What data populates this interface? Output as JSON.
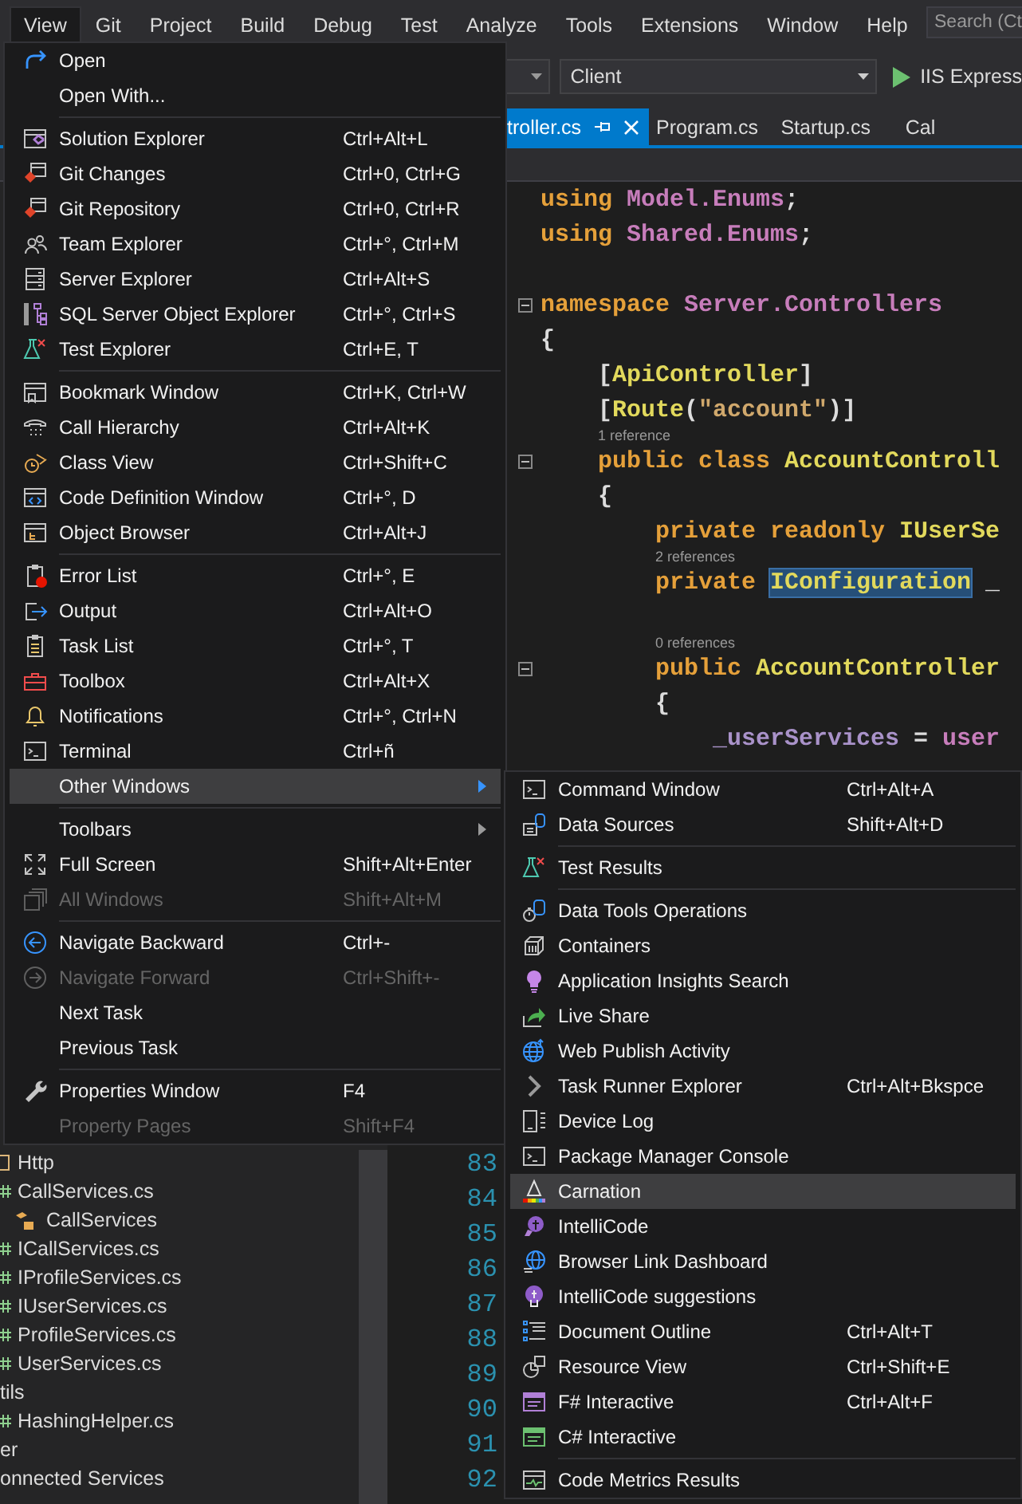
{
  "menu_bar": {
    "items": [
      {
        "label": "View",
        "selected": true
      },
      {
        "label": "Git",
        "selected": false
      },
      {
        "label": "Project",
        "selected": false
      },
      {
        "label": "Build",
        "selected": false
      },
      {
        "label": "Debug",
        "selected": false
      },
      {
        "label": "Test",
        "selected": false
      },
      {
        "label": "Analyze",
        "selected": false
      },
      {
        "label": "Tools",
        "selected": false
      },
      {
        "label": "Extensions",
        "selected": false
      },
      {
        "label": "Window",
        "selected": false
      },
      {
        "label": "Help",
        "selected": false
      }
    ],
    "search": {
      "placeholder": "Search (Ct"
    }
  },
  "toolbar": {
    "startup_project": "Client",
    "run_button": "IIS Express"
  },
  "tabs": [
    {
      "label": "troller.cs",
      "selected": true
    },
    {
      "label": "Program.cs",
      "selected": false
    },
    {
      "label": "Startup.cs",
      "selected": false
    },
    {
      "label": "Cal",
      "selected": false
    }
  ],
  "solution_explorer": {
    "tree": [
      {
        "label": "Http",
        "kind": "folder"
      },
      {
        "label": "CallServices.cs",
        "kind": "file",
        "children": [
          {
            "label": "CallServices",
            "kind": "class"
          }
        ]
      },
      {
        "label": "ICallServices.cs",
        "kind": "file"
      },
      {
        "label": "IProfileServices.cs",
        "kind": "file"
      },
      {
        "label": "IUserServices.cs",
        "kind": "file"
      },
      {
        "label": "ProfileServices.cs",
        "kind": "file"
      },
      {
        "label": "UserServices.cs",
        "kind": "file"
      },
      {
        "label": "tils",
        "kind": "node",
        "children": [
          {
            "label": "HashingHelper.cs",
            "kind": "file"
          }
        ]
      },
      {
        "label": "er",
        "kind": "node"
      },
      {
        "label": "onnected Services",
        "kind": "node"
      }
    ]
  },
  "line_numbers": [
    "83",
    "84",
    "85",
    "86",
    "87",
    "88",
    "89",
    "90",
    "91",
    "92"
  ],
  "code": {
    "lines": [
      {
        "kind": "code",
        "collapsible": false,
        "tokens": [
          {
            "text": "using ",
            "kind": "keyword"
          },
          {
            "text": "Model.Enums",
            "kind": "namespace"
          },
          {
            "text": ";",
            "kind": "plain"
          }
        ]
      },
      {
        "kind": "code",
        "collapsible": false,
        "tokens": [
          {
            "text": "using ",
            "kind": "keyword"
          },
          {
            "text": "Shared.Enums",
            "kind": "namespace"
          },
          {
            "text": ";",
            "kind": "plain"
          }
        ]
      },
      {
        "kind": "blank",
        "collapsible": false
      },
      {
        "kind": "code",
        "collapsible": true,
        "tokens": [
          {
            "text": "namespace ",
            "kind": "keyword"
          },
          {
            "text": "Server.Controllers",
            "kind": "namespace"
          }
        ]
      },
      {
        "kind": "code",
        "collapsible": false,
        "tokens": [
          {
            "text": "{",
            "kind": "plain"
          }
        ],
        "children": [
          {
            "kind": "code",
            "collapsible": false,
            "tokens": [
              {
                "text": "[",
                "kind": "plain"
              },
              {
                "text": "ApiController",
                "kind": "type"
              },
              {
                "text": "]",
                "kind": "plain"
              }
            ]
          },
          {
            "kind": "code",
            "collapsible": false,
            "tokens": [
              {
                "text": "[",
                "kind": "plain"
              },
              {
                "text": "Route",
                "kind": "type"
              },
              {
                "text": "(",
                "kind": "plain"
              },
              {
                "text": "\"account\"",
                "kind": "string"
              },
              {
                "text": ")]",
                "kind": "plain"
              }
            ]
          },
          {
            "kind": "hint",
            "collapsible": false,
            "tokens": [
              {
                "text": "1 reference",
                "kind": "hint"
              }
            ]
          },
          {
            "kind": "code",
            "collapsible": true,
            "tokens": [
              {
                "text": "public class ",
                "kind": "keyword"
              },
              {
                "text": "AccountControll",
                "kind": "type"
              }
            ]
          },
          {
            "kind": "code",
            "collapsible": false,
            "tokens": [
              {
                "text": "{",
                "kind": "plain"
              }
            ],
            "children": [
              {
                "kind": "code",
                "collapsible": false,
                "tokens": [
                  {
                    "text": "private readonly ",
                    "kind": "keyword"
                  },
                  {
                    "text": "IUserSe",
                    "kind": "type"
                  }
                ]
              },
              {
                "kind": "hint",
                "collapsible": false,
                "tokens": [
                  {
                    "text": "2 references",
                    "kind": "hint"
                  }
                ]
              },
              {
                "kind": "code",
                "collapsible": false,
                "tokens": [
                  {
                    "text": "private ",
                    "kind": "keyword"
                  },
                  {
                    "text": "IConfiguration",
                    "kind": "selected"
                  },
                  {
                    "text": " _",
                    "kind": "plain"
                  }
                ]
              },
              {
                "kind": "blank",
                "collapsible": false
              },
              {
                "kind": "hint",
                "collapsible": false,
                "tokens": [
                  {
                    "text": "0 references",
                    "kind": "hint"
                  }
                ]
              },
              {
                "kind": "code",
                "collapsible": true,
                "tokens": [
                  {
                    "text": "public ",
                    "kind": "keyword"
                  },
                  {
                    "text": "AccountController",
                    "kind": "type"
                  }
                ]
              },
              {
                "kind": "code",
                "collapsible": false,
                "tokens": [
                  {
                    "text": "{",
                    "kind": "plain"
                  }
                ],
                "children": [
                  {
                    "kind": "code",
                    "collapsible": false,
                    "tokens": [
                      {
                        "text": "_userServices",
                        "kind": "field"
                      },
                      {
                        "text": " = ",
                        "kind": "plain"
                      },
                      {
                        "text": "user",
                        "kind": "parameter"
                      }
                    ]
                  }
                ]
              }
            ]
          }
        ]
      }
    ]
  },
  "view_menu": {
    "groups": [
      [
        {
          "label": "Open",
          "disabled": false,
          "selected": false,
          "submenu": false
        },
        {
          "label": "Open With...",
          "disabled": false,
          "selected": false,
          "submenu": false
        }
      ],
      [
        {
          "label": "Solution Explorer",
          "shortcut": "Ctrl+Alt+L",
          "disabled": false,
          "selected": false,
          "submenu": false
        },
        {
          "label": "Git Changes",
          "shortcut": "Ctrl+0, Ctrl+G",
          "disabled": false,
          "selected": false,
          "submenu": false
        },
        {
          "label": "Git Repository",
          "shortcut": "Ctrl+0, Ctrl+R",
          "disabled": false,
          "selected": false,
          "submenu": false
        },
        {
          "label": "Team Explorer",
          "shortcut": "Ctrl+°, Ctrl+M",
          "disabled": false,
          "selected": false,
          "submenu": false
        },
        {
          "label": "Server Explorer",
          "shortcut": "Ctrl+Alt+S",
          "disabled": false,
          "selected": false,
          "submenu": false
        },
        {
          "label": "SQL Server Object Explorer",
          "shortcut": "Ctrl+°, Ctrl+S",
          "disabled": false,
          "selected": false,
          "submenu": false
        },
        {
          "label": "Test Explorer",
          "shortcut": "Ctrl+E, T",
          "disabled": false,
          "selected": false,
          "submenu": false
        }
      ],
      [
        {
          "label": "Bookmark Window",
          "shortcut": "Ctrl+K, Ctrl+W",
          "disabled": false,
          "selected": false,
          "submenu": false
        },
        {
          "label": "Call Hierarchy",
          "shortcut": "Ctrl+Alt+K",
          "disabled": false,
          "selected": false,
          "submenu": false
        },
        {
          "label": "Class View",
          "shortcut": "Ctrl+Shift+C",
          "disabled": false,
          "selected": false,
          "submenu": false
        },
        {
          "label": "Code Definition Window",
          "shortcut": "Ctrl+°, D",
          "disabled": false,
          "selected": false,
          "submenu": false
        },
        {
          "label": "Object Browser",
          "shortcut": "Ctrl+Alt+J",
          "disabled": false,
          "selected": false,
          "submenu": false
        }
      ],
      [
        {
          "label": "Error List",
          "shortcut": "Ctrl+°, E",
          "disabled": false,
          "selected": false,
          "submenu": false
        },
        {
          "label": "Output",
          "shortcut": "Ctrl+Alt+O",
          "disabled": false,
          "selected": false,
          "submenu": false
        },
        {
          "label": "Task List",
          "shortcut": "Ctrl+°, T",
          "disabled": false,
          "selected": false,
          "submenu": false
        },
        {
          "label": "Toolbox",
          "shortcut": "Ctrl+Alt+X",
          "disabled": false,
          "selected": false,
          "submenu": false
        },
        {
          "label": "Notifications",
          "shortcut": "Ctrl+°, Ctrl+N",
          "disabled": false,
          "selected": false,
          "submenu": false
        },
        {
          "label": "Terminal",
          "shortcut": "Ctrl+ñ",
          "disabled": false,
          "selected": false,
          "submenu": false
        },
        {
          "label": "Other Windows",
          "disabled": false,
          "selected": true,
          "submenu": true
        }
      ],
      [
        {
          "label": "Toolbars",
          "disabled": false,
          "selected": false,
          "submenu": true
        },
        {
          "label": "Full Screen",
          "shortcut": "Shift+Alt+Enter",
          "disabled": false,
          "selected": false,
          "submenu": false
        },
        {
          "label": "All Windows",
          "shortcut": "Shift+Alt+M",
          "disabled": true,
          "selected": false,
          "submenu": false
        }
      ],
      [
        {
          "label": "Navigate Backward",
          "shortcut": "Ctrl+-",
          "disabled": false,
          "selected": false,
          "submenu": false
        },
        {
          "label": "Navigate Forward",
          "shortcut": "Ctrl+Shift+-",
          "disabled": true,
          "selected": false,
          "submenu": false
        },
        {
          "label": "Next Task",
          "disabled": false,
          "selected": false,
          "submenu": false
        },
        {
          "label": "Previous Task",
          "disabled": false,
          "selected": false,
          "submenu": false
        }
      ],
      [
        {
          "label": "Properties Window",
          "shortcut": "F4",
          "disabled": false,
          "selected": false,
          "submenu": false
        },
        {
          "label": "Property Pages",
          "shortcut": "Shift+F4",
          "disabled": true,
          "selected": false,
          "submenu": false
        }
      ]
    ]
  },
  "other_windows_menu": {
    "groups": [
      [
        {
          "label": "Command Window",
          "shortcut": "Ctrl+Alt+A",
          "disabled": false,
          "selected": false,
          "submenu": false
        },
        {
          "label": "Data Sources",
          "shortcut": "Shift+Alt+D",
          "disabled": false,
          "selected": false,
          "submenu": false
        }
      ],
      [
        {
          "label": "Test Results",
          "disabled": false,
          "selected": false,
          "submenu": false
        }
      ],
      [
        {
          "label": "Data Tools Operations",
          "disabled": false,
          "selected": false,
          "submenu": false
        },
        {
          "label": "Containers",
          "disabled": false,
          "selected": false,
          "submenu": false
        },
        {
          "label": "Application Insights Search",
          "disabled": false,
          "selected": false,
          "submenu": false
        },
        {
          "label": "Live Share",
          "disabled": false,
          "selected": false,
          "submenu": false
        },
        {
          "label": "Web Publish Activity",
          "disabled": false,
          "selected": false,
          "submenu": false
        },
        {
          "label": "Task Runner Explorer",
          "shortcut": "Ctrl+Alt+Bkspce",
          "disabled": false,
          "selected": false,
          "submenu": false
        },
        {
          "label": "Device Log",
          "disabled": false,
          "selected": false,
          "submenu": false
        },
        {
          "label": "Package Manager Console",
          "disabled": false,
          "selected": false,
          "submenu": false
        },
        {
          "label": "Carnation",
          "disabled": false,
          "selected": true,
          "submenu": false
        },
        {
          "label": "IntelliCode",
          "disabled": false,
          "selected": false,
          "submenu": false
        },
        {
          "label": "Browser Link Dashboard",
          "disabled": false,
          "selected": false,
          "submenu": false
        },
        {
          "label": "IntelliCode suggestions",
          "disabled": false,
          "selected": false,
          "submenu": false
        },
        {
          "label": "Document Outline",
          "shortcut": "Ctrl+Alt+T",
          "disabled": false,
          "selected": false,
          "submenu": false
        },
        {
          "label": "Resource View",
          "shortcut": "Ctrl+Shift+E",
          "disabled": false,
          "selected": false,
          "submenu": false
        },
        {
          "label": "F# Interactive",
          "shortcut": "Ctrl+Alt+F",
          "disabled": false,
          "selected": false,
          "submenu": false
        },
        {
          "label": "C# Interactive",
          "disabled": false,
          "selected": false,
          "submenu": false
        }
      ],
      [
        {
          "label": "Code Metrics Results",
          "disabled": false,
          "selected": false,
          "submenu": false
        }
      ]
    ]
  }
}
